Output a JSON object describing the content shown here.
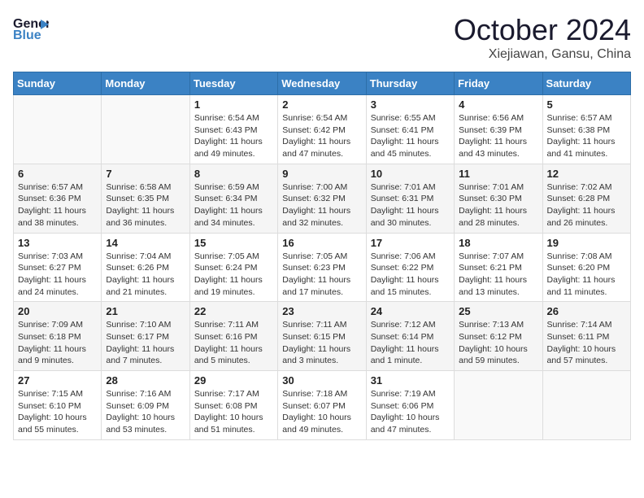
{
  "header": {
    "logo_line1": "General",
    "logo_line2": "Blue",
    "month": "October 2024",
    "location": "Xiejiawan, Gansu, China"
  },
  "weekdays": [
    "Sunday",
    "Monday",
    "Tuesday",
    "Wednesday",
    "Thursday",
    "Friday",
    "Saturday"
  ],
  "weeks": [
    [
      {
        "day": "",
        "sunrise": "",
        "sunset": "",
        "daylight": ""
      },
      {
        "day": "",
        "sunrise": "",
        "sunset": "",
        "daylight": ""
      },
      {
        "day": "1",
        "sunrise": "Sunrise: 6:54 AM",
        "sunset": "Sunset: 6:43 PM",
        "daylight": "Daylight: 11 hours and 49 minutes."
      },
      {
        "day": "2",
        "sunrise": "Sunrise: 6:54 AM",
        "sunset": "Sunset: 6:42 PM",
        "daylight": "Daylight: 11 hours and 47 minutes."
      },
      {
        "day": "3",
        "sunrise": "Sunrise: 6:55 AM",
        "sunset": "Sunset: 6:41 PM",
        "daylight": "Daylight: 11 hours and 45 minutes."
      },
      {
        "day": "4",
        "sunrise": "Sunrise: 6:56 AM",
        "sunset": "Sunset: 6:39 PM",
        "daylight": "Daylight: 11 hours and 43 minutes."
      },
      {
        "day": "5",
        "sunrise": "Sunrise: 6:57 AM",
        "sunset": "Sunset: 6:38 PM",
        "daylight": "Daylight: 11 hours and 41 minutes."
      }
    ],
    [
      {
        "day": "6",
        "sunrise": "Sunrise: 6:57 AM",
        "sunset": "Sunset: 6:36 PM",
        "daylight": "Daylight: 11 hours and 38 minutes."
      },
      {
        "day": "7",
        "sunrise": "Sunrise: 6:58 AM",
        "sunset": "Sunset: 6:35 PM",
        "daylight": "Daylight: 11 hours and 36 minutes."
      },
      {
        "day": "8",
        "sunrise": "Sunrise: 6:59 AM",
        "sunset": "Sunset: 6:34 PM",
        "daylight": "Daylight: 11 hours and 34 minutes."
      },
      {
        "day": "9",
        "sunrise": "Sunrise: 7:00 AM",
        "sunset": "Sunset: 6:32 PM",
        "daylight": "Daylight: 11 hours and 32 minutes."
      },
      {
        "day": "10",
        "sunrise": "Sunrise: 7:01 AM",
        "sunset": "Sunset: 6:31 PM",
        "daylight": "Daylight: 11 hours and 30 minutes."
      },
      {
        "day": "11",
        "sunrise": "Sunrise: 7:01 AM",
        "sunset": "Sunset: 6:30 PM",
        "daylight": "Daylight: 11 hours and 28 minutes."
      },
      {
        "day": "12",
        "sunrise": "Sunrise: 7:02 AM",
        "sunset": "Sunset: 6:28 PM",
        "daylight": "Daylight: 11 hours and 26 minutes."
      }
    ],
    [
      {
        "day": "13",
        "sunrise": "Sunrise: 7:03 AM",
        "sunset": "Sunset: 6:27 PM",
        "daylight": "Daylight: 11 hours and 24 minutes."
      },
      {
        "day": "14",
        "sunrise": "Sunrise: 7:04 AM",
        "sunset": "Sunset: 6:26 PM",
        "daylight": "Daylight: 11 hours and 21 minutes."
      },
      {
        "day": "15",
        "sunrise": "Sunrise: 7:05 AM",
        "sunset": "Sunset: 6:24 PM",
        "daylight": "Daylight: 11 hours and 19 minutes."
      },
      {
        "day": "16",
        "sunrise": "Sunrise: 7:05 AM",
        "sunset": "Sunset: 6:23 PM",
        "daylight": "Daylight: 11 hours and 17 minutes."
      },
      {
        "day": "17",
        "sunrise": "Sunrise: 7:06 AM",
        "sunset": "Sunset: 6:22 PM",
        "daylight": "Daylight: 11 hours and 15 minutes."
      },
      {
        "day": "18",
        "sunrise": "Sunrise: 7:07 AM",
        "sunset": "Sunset: 6:21 PM",
        "daylight": "Daylight: 11 hours and 13 minutes."
      },
      {
        "day": "19",
        "sunrise": "Sunrise: 7:08 AM",
        "sunset": "Sunset: 6:20 PM",
        "daylight": "Daylight: 11 hours and 11 minutes."
      }
    ],
    [
      {
        "day": "20",
        "sunrise": "Sunrise: 7:09 AM",
        "sunset": "Sunset: 6:18 PM",
        "daylight": "Daylight: 11 hours and 9 minutes."
      },
      {
        "day": "21",
        "sunrise": "Sunrise: 7:10 AM",
        "sunset": "Sunset: 6:17 PM",
        "daylight": "Daylight: 11 hours and 7 minutes."
      },
      {
        "day": "22",
        "sunrise": "Sunrise: 7:11 AM",
        "sunset": "Sunset: 6:16 PM",
        "daylight": "Daylight: 11 hours and 5 minutes."
      },
      {
        "day": "23",
        "sunrise": "Sunrise: 7:11 AM",
        "sunset": "Sunset: 6:15 PM",
        "daylight": "Daylight: 11 hours and 3 minutes."
      },
      {
        "day": "24",
        "sunrise": "Sunrise: 7:12 AM",
        "sunset": "Sunset: 6:14 PM",
        "daylight": "Daylight: 11 hours and 1 minute."
      },
      {
        "day": "25",
        "sunrise": "Sunrise: 7:13 AM",
        "sunset": "Sunset: 6:12 PM",
        "daylight": "Daylight: 10 hours and 59 minutes."
      },
      {
        "day": "26",
        "sunrise": "Sunrise: 7:14 AM",
        "sunset": "Sunset: 6:11 PM",
        "daylight": "Daylight: 10 hours and 57 minutes."
      }
    ],
    [
      {
        "day": "27",
        "sunrise": "Sunrise: 7:15 AM",
        "sunset": "Sunset: 6:10 PM",
        "daylight": "Daylight: 10 hours and 55 minutes."
      },
      {
        "day": "28",
        "sunrise": "Sunrise: 7:16 AM",
        "sunset": "Sunset: 6:09 PM",
        "daylight": "Daylight: 10 hours and 53 minutes."
      },
      {
        "day": "29",
        "sunrise": "Sunrise: 7:17 AM",
        "sunset": "Sunset: 6:08 PM",
        "daylight": "Daylight: 10 hours and 51 minutes."
      },
      {
        "day": "30",
        "sunrise": "Sunrise: 7:18 AM",
        "sunset": "Sunset: 6:07 PM",
        "daylight": "Daylight: 10 hours and 49 minutes."
      },
      {
        "day": "31",
        "sunrise": "Sunrise: 7:19 AM",
        "sunset": "Sunset: 6:06 PM",
        "daylight": "Daylight: 10 hours and 47 minutes."
      },
      {
        "day": "",
        "sunrise": "",
        "sunset": "",
        "daylight": ""
      },
      {
        "day": "",
        "sunrise": "",
        "sunset": "",
        "daylight": ""
      }
    ]
  ]
}
